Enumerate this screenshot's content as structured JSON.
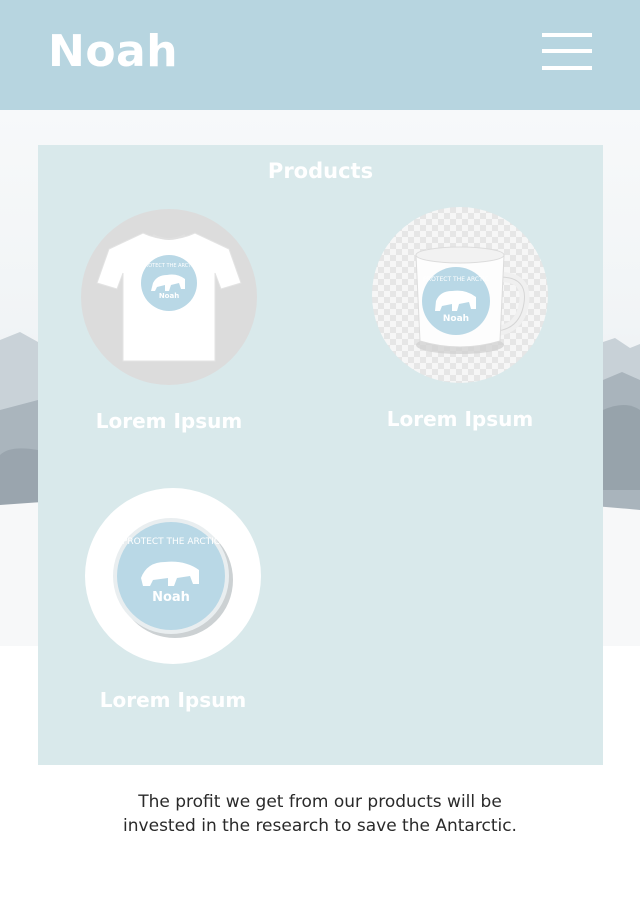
{
  "header": {
    "brand": "Noah",
    "menu_icon": "hamburger-menu-icon",
    "background_color": "#b7d5e0"
  },
  "products_section": {
    "title": "Products",
    "background_color": "#d9e9eb",
    "items": [
      {
        "label": "Lorem Ipsum",
        "image": "t-shirt-product-image"
      },
      {
        "label": "Lorem Ipsum",
        "image": "mug-product-image"
      },
      {
        "label": "Lorem Ipsum",
        "image": "badge-product-image"
      }
    ],
    "logo": {
      "arc_text": "PROTECT THE ARCTIC",
      "name": "Noah",
      "color": "#b9d8e6"
    }
  },
  "footer": {
    "line1": "The profit we get from our products will be",
    "line2": "invested in the research to save the Antarctic."
  }
}
